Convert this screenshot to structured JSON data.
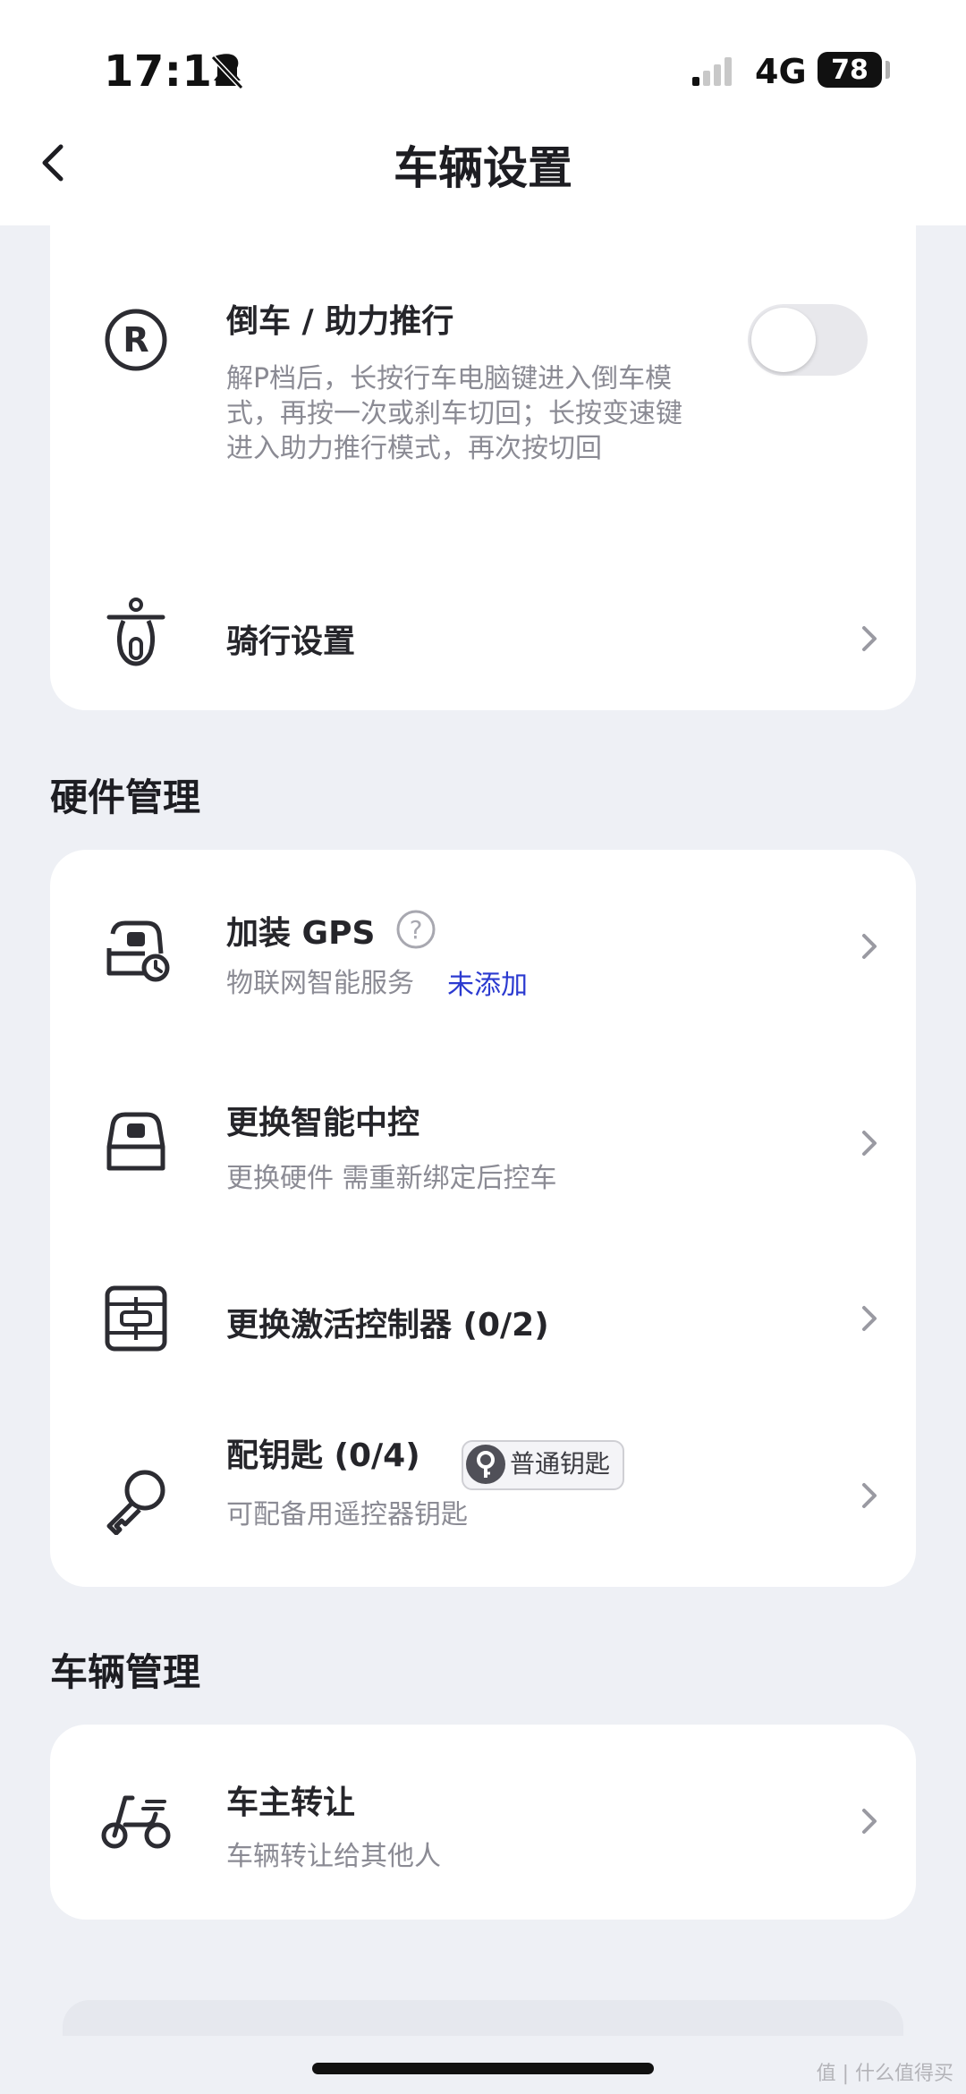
{
  "status_bar": {
    "time": "17:12",
    "network": "4G",
    "battery": "78"
  },
  "header": {
    "title": "车辆设置"
  },
  "card_top": {
    "reverse": {
      "title": "倒车 / 助力推行",
      "description": "解P档后，长按行车电脑键进入倒车模式，再按一次或刹车切回；长按变速键进入助力推行模式，再次按切回",
      "icon_letter": "R",
      "toggle_on": false
    },
    "riding": {
      "title": "骑行设置"
    }
  },
  "hardware": {
    "section_title": "硬件管理",
    "gps": {
      "title": "加装 GPS",
      "help_mark": "?",
      "subtitle": "物联网智能服务",
      "status": "未添加"
    },
    "central_control": {
      "title": "更换智能中控",
      "subtitle": "更换硬件 需重新绑定后控车"
    },
    "controller": {
      "title": "更换激活控制器 (0/2)"
    },
    "key": {
      "title": "配钥匙 (0/4)",
      "badge": "普通钥匙",
      "subtitle": "可配备用遥控器钥匙"
    }
  },
  "vehicle": {
    "section_title": "车辆管理",
    "transfer": {
      "title": "车主转让",
      "subtitle": "车辆转让给其他人"
    }
  },
  "watermark": "值 | 什么值得买",
  "colors": {
    "background": "#eef0f5",
    "card": "#ffffff",
    "link_blue": "#2b3ad0",
    "secondary_text": "#8b8b94"
  }
}
